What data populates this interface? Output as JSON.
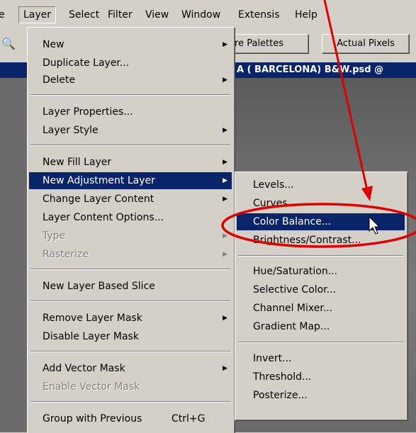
{
  "menubar": {
    "items": [
      "e",
      "Layer",
      "Select",
      "Filter",
      "View",
      "Window",
      "Extensis",
      "Help"
    ]
  },
  "options_bar": {
    "palettes_label": "re Palettes",
    "actual_pixels_label": "Actual Pixels"
  },
  "document": {
    "title_fragment": "A ( BARCELONA) B&W.psd @"
  },
  "layer_menu": {
    "items": [
      {
        "label": "New",
        "submenu": true,
        "disabled": false
      },
      {
        "label": "Duplicate Layer...",
        "submenu": false,
        "disabled": false
      },
      {
        "label": "Delete",
        "submenu": true,
        "disabled": false
      },
      {
        "label": "Layer Properties...",
        "submenu": false,
        "disabled": false
      },
      {
        "label": "Layer Style",
        "submenu": true,
        "disabled": false
      },
      {
        "label": "New Fill Layer",
        "submenu": true,
        "disabled": false
      },
      {
        "label": "New Adjustment Layer",
        "submenu": true,
        "disabled": false,
        "highlighted": true
      },
      {
        "label": "Change Layer Content",
        "submenu": true,
        "disabled": false
      },
      {
        "label": "Layer Content Options...",
        "submenu": false,
        "disabled": false
      },
      {
        "label": "Type",
        "submenu": true,
        "disabled": true
      },
      {
        "label": "Rasterize",
        "submenu": true,
        "disabled": true
      },
      {
        "label": "New Layer Based Slice",
        "submenu": false,
        "disabled": false
      },
      {
        "label": "Remove Layer Mask",
        "submenu": true,
        "disabled": false
      },
      {
        "label": "Disable Layer Mask",
        "submenu": false,
        "disabled": false
      },
      {
        "label": "Add Vector Mask",
        "submenu": true,
        "disabled": false
      },
      {
        "label": "Enable Vector Mask",
        "submenu": false,
        "disabled": true
      },
      {
        "label": "Group with Previous",
        "shortcut": "Ctrl+G",
        "submenu": false,
        "disabled": false
      }
    ]
  },
  "adjustment_submenu": {
    "items": [
      {
        "label": "Levels..."
      },
      {
        "label": "Curves..."
      },
      {
        "label": "Color Balance...",
        "highlighted": true
      },
      {
        "label": "Brightness/Contrast..."
      },
      {
        "label": "Hue/Saturation..."
      },
      {
        "label": "Selective Color..."
      },
      {
        "label": "Channel Mixer..."
      },
      {
        "label": "Gradient Map..."
      },
      {
        "label": "Invert..."
      },
      {
        "label": "Threshold..."
      },
      {
        "label": "Posterize..."
      }
    ]
  },
  "annotation": {
    "arrow_color": "#e00000",
    "ellipse_color": "#e00000"
  },
  "colors": {
    "menu_bg": "#d4d0c8",
    "highlight": "#0a246a",
    "highlight_text": "#ffffff",
    "disabled_text": "#808080"
  },
  "icons": [
    "submenu-arrow-icon",
    "mouse-cursor-icon",
    "zoom-icon"
  ]
}
